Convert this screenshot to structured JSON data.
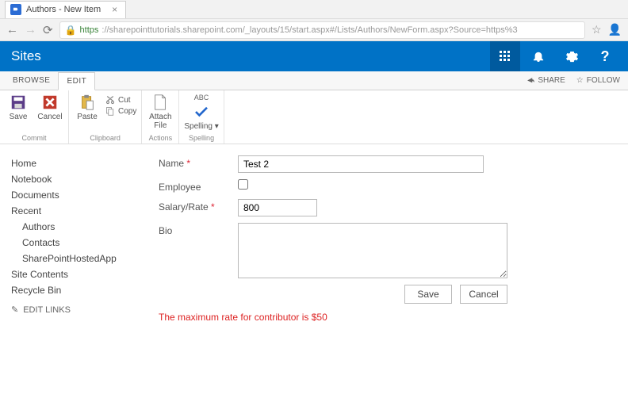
{
  "browser": {
    "tab_title": "Authors - New Item",
    "url_prefix": "https",
    "url_rest": "://sharepointtutorials.sharepoint.com/_layouts/15/start.aspx#/Lists/Authors/NewForm.aspx?Source=https%3"
  },
  "suite": {
    "title": "Sites"
  },
  "ribbon_tabs": {
    "tabs": [
      "BROWSE",
      "EDIT"
    ],
    "active_index": 1,
    "share_label": "SHARE",
    "follow_label": "FOLLOW"
  },
  "ribbon": {
    "commit": {
      "save": "Save",
      "cancel": "Cancel",
      "group": "Commit"
    },
    "clipboard": {
      "paste": "Paste",
      "cut": "Cut",
      "copy": "Copy",
      "group": "Clipboard"
    },
    "actions": {
      "attach": "Attach\nFile",
      "group": "Actions"
    },
    "spelling": {
      "abc": "ABC",
      "spelling": "Spelling",
      "group": "Spelling"
    }
  },
  "sidebar": {
    "items": [
      "Home",
      "Notebook",
      "Documents",
      "Recent"
    ],
    "recent_items": [
      "Authors",
      "Contacts",
      "SharePointHostedApp"
    ],
    "bottom_items": [
      "Site Contents",
      "Recycle Bin"
    ],
    "edit_links": "EDIT LINKS"
  },
  "form": {
    "fields": {
      "name": {
        "label": "Name",
        "value": "Test 2",
        "required": true
      },
      "employee": {
        "label": "Employee",
        "checked": false
      },
      "salary": {
        "label": "Salary/Rate",
        "value": "800",
        "required": true
      },
      "bio": {
        "label": "Bio",
        "value": ""
      }
    },
    "buttons": {
      "save": "Save",
      "cancel": "Cancel"
    },
    "validation": "The maximum rate for contributor is $50"
  }
}
